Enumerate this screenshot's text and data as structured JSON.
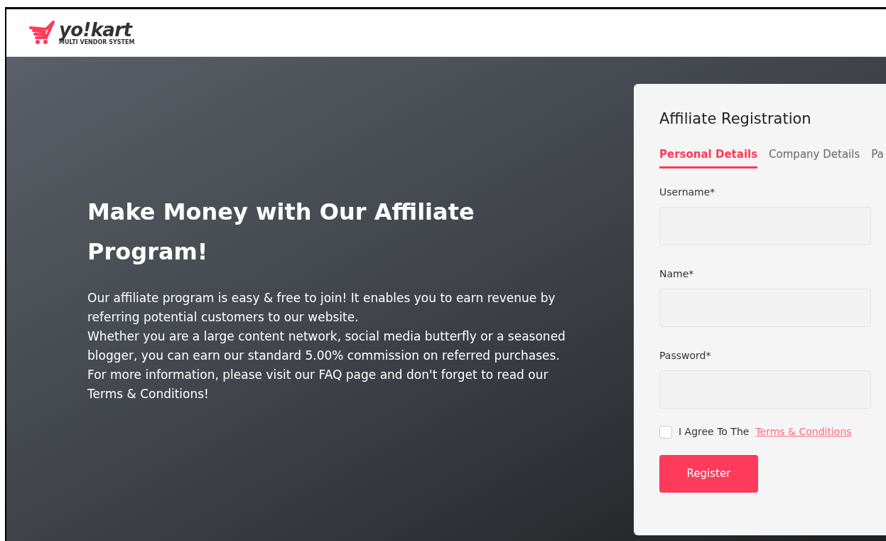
{
  "logo": {
    "wordmark": "yo!kart",
    "tagline": "MULTI VENDOR SYSTEM"
  },
  "hero": {
    "heading": "Make Money with Our Affiliate Program!",
    "paragraphs": [
      "Our affiliate program is easy & free to join! It enables you to earn revenue by referring potential customers to our website.",
      "Whether you are a large content network, social media butterfly or a seasoned blogger, you can earn our standard 5.00% commission on referred purchases.",
      "For more information, please visit our FAQ page and don't forget to read our Terms & Conditions!"
    ]
  },
  "form": {
    "title": "Affiliate Registration",
    "tabs": [
      {
        "label": "Personal Details",
        "selected": true
      },
      {
        "label": "Company Details",
        "selected": false
      },
      {
        "label": "Pa",
        "selected": false
      }
    ],
    "fields": [
      {
        "label": "Username*"
      },
      {
        "label": "Name*"
      },
      {
        "label": "Password*"
      }
    ],
    "agree": {
      "checked": false,
      "text": "I Agree To The",
      "link": "Terms & Conditions"
    },
    "submit": "Register"
  }
}
